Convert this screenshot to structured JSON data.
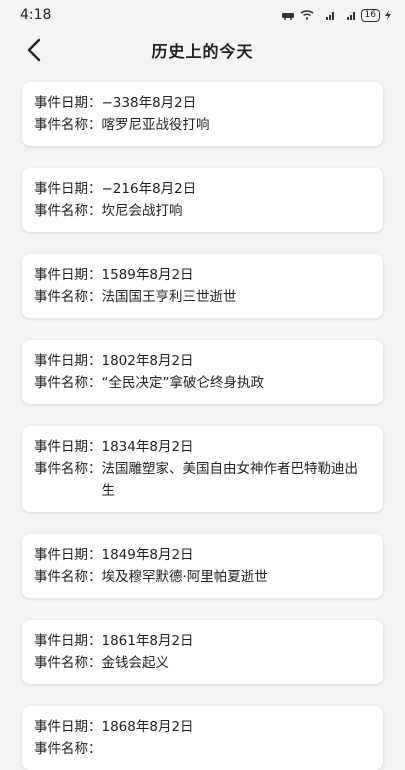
{
  "status": {
    "time": "4:18",
    "battery": "16"
  },
  "header": {
    "title": "历史上的今天"
  },
  "labels": {
    "date": "事件日期：",
    "name": "事件名称："
  },
  "events": [
    {
      "date": "−338年8月2日",
      "name": "喀罗尼亚战役打响"
    },
    {
      "date": "−216年8月2日",
      "name": "坎尼会战打响"
    },
    {
      "date": "1589年8月2日",
      "name": "法国国王亨利三世逝世"
    },
    {
      "date": "1802年8月2日",
      "name": "“全民决定”拿破仑终身执政"
    },
    {
      "date": "1834年8月2日",
      "name": "法国雕塑家、美国自由女神作者巴特勒迪出生"
    },
    {
      "date": "1849年8月2日",
      "name": "埃及穆罕默德·阿里帕夏逝世"
    },
    {
      "date": "1861年8月2日",
      "name": "金钱会起义"
    },
    {
      "date": "1868年8月2日",
      "name": ""
    }
  ]
}
